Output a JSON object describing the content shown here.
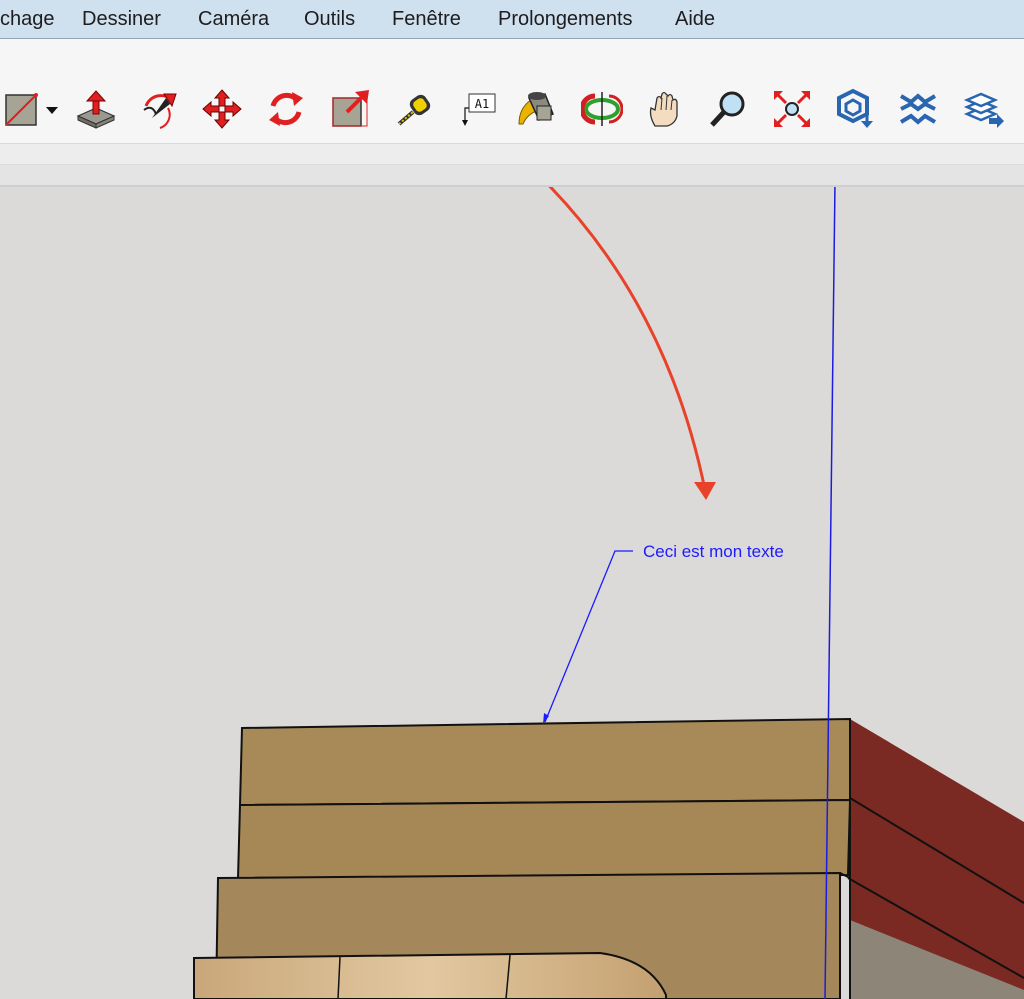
{
  "menubar": {
    "items": [
      "chage",
      "Dessiner",
      "Caméra",
      "Outils",
      "Fenêtre",
      "Prolongements",
      "Aide"
    ]
  },
  "toolbar": {
    "tools": [
      {
        "icon": "rectangle-icon"
      },
      {
        "icon": "push-pull-icon"
      },
      {
        "icon": "follow-me-icon"
      },
      {
        "icon": "move-icon"
      },
      {
        "icon": "rotate-icon"
      },
      {
        "icon": "scale-icon"
      },
      {
        "icon": "tape-measure-icon"
      },
      {
        "icon": "text-tool-icon",
        "glyph": "A1"
      },
      {
        "icon": "paint-bucket-icon"
      },
      {
        "icon": "orbit-icon"
      },
      {
        "icon": "pan-icon"
      },
      {
        "icon": "zoom-icon"
      },
      {
        "icon": "zoom-extents-icon"
      },
      {
        "icon": "3d-warehouse-icon"
      },
      {
        "icon": "extension-warehouse-icon"
      },
      {
        "icon": "layout-send-icon"
      }
    ]
  },
  "canvas": {
    "annotation_text": "Ceci est mon texte"
  },
  "colors": {
    "accent_arrow": "#e8432a",
    "leader_line": "#1b1bff",
    "blue_axis": "#1c1ce0",
    "mdf": "#a88958",
    "red_side": "#7a2a22"
  }
}
